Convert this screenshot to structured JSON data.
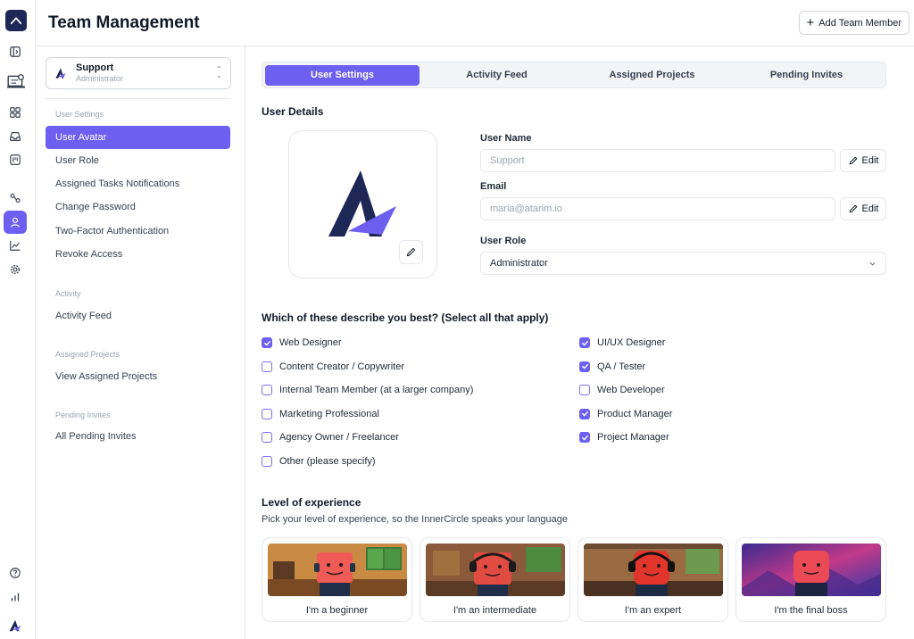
{
  "app": {
    "page_title": "Team Management",
    "add_member_label": "Add Team Member"
  },
  "workspace": {
    "name": "Support",
    "role": "Administrator"
  },
  "sidebar": {
    "sections": [
      {
        "title": "User Settings",
        "items": [
          "User Avatar",
          "User Role",
          "Assigned Tasks Notifications",
          "Change Password",
          "Two-Factor Authentication",
          "Revoke Access"
        ]
      },
      {
        "title": "Activity",
        "items": [
          "Activity Feed"
        ]
      },
      {
        "title": "Assigned Projects",
        "items": [
          "View Assigned Projects"
        ]
      },
      {
        "title": "Pending Invites",
        "items": [
          "All Pending Invites"
        ]
      }
    ],
    "active_item": "User Avatar"
  },
  "tabs": [
    "User Settings",
    "Activity Feed",
    "Assigned Projects",
    "Pending Invites"
  ],
  "active_tab": "User Settings",
  "details": {
    "title": "User Details",
    "user_name_label": "User Name",
    "user_name_placeholder": "Support",
    "email_label": "Email",
    "email_placeholder": "maria@atarim.io",
    "role_label": "User Role",
    "role_value": "Administrator",
    "edit_label": "Edit"
  },
  "describe": {
    "title": "Which of these describe you best? (Select all that apply)",
    "left": [
      {
        "label": "Web Designer",
        "checked": true
      },
      {
        "label": "Content Creator / Copywriter",
        "checked": false
      },
      {
        "label": "Internal Team Member (at a larger company)",
        "checked": false
      },
      {
        "label": "Marketing Professional",
        "checked": false
      },
      {
        "label": "Agency Owner / Freelancer",
        "checked": false
      },
      {
        "label": "Other (please specify)",
        "checked": false
      }
    ],
    "right": [
      {
        "label": "UI/UX Designer",
        "checked": true
      },
      {
        "label": "QA / Tester",
        "checked": true
      },
      {
        "label": "Web Developer",
        "checked": false
      },
      {
        "label": "Product Manager",
        "checked": true
      },
      {
        "label": "Project Manager",
        "checked": true
      }
    ]
  },
  "experience": {
    "title": "Level of experience",
    "subtitle": "Pick your level of experience, so the InnerCircle speaks your language",
    "levels": [
      "I'm a beginner",
      "I'm an intermediate",
      "I'm an expert",
      "I'm the final boss"
    ]
  },
  "colors": {
    "accent": "#6d5ff0",
    "brand_navy": "#1e2756"
  },
  "icons": {
    "rail": [
      "panel-icon",
      "device-icon",
      "grid-icon",
      "inbox-icon",
      "board-icon",
      "integrations-icon",
      "user-icon",
      "chart-line-icon",
      "settings-icon",
      "help-icon",
      "bar-chart-icon",
      "atarim-logo-icon"
    ]
  }
}
